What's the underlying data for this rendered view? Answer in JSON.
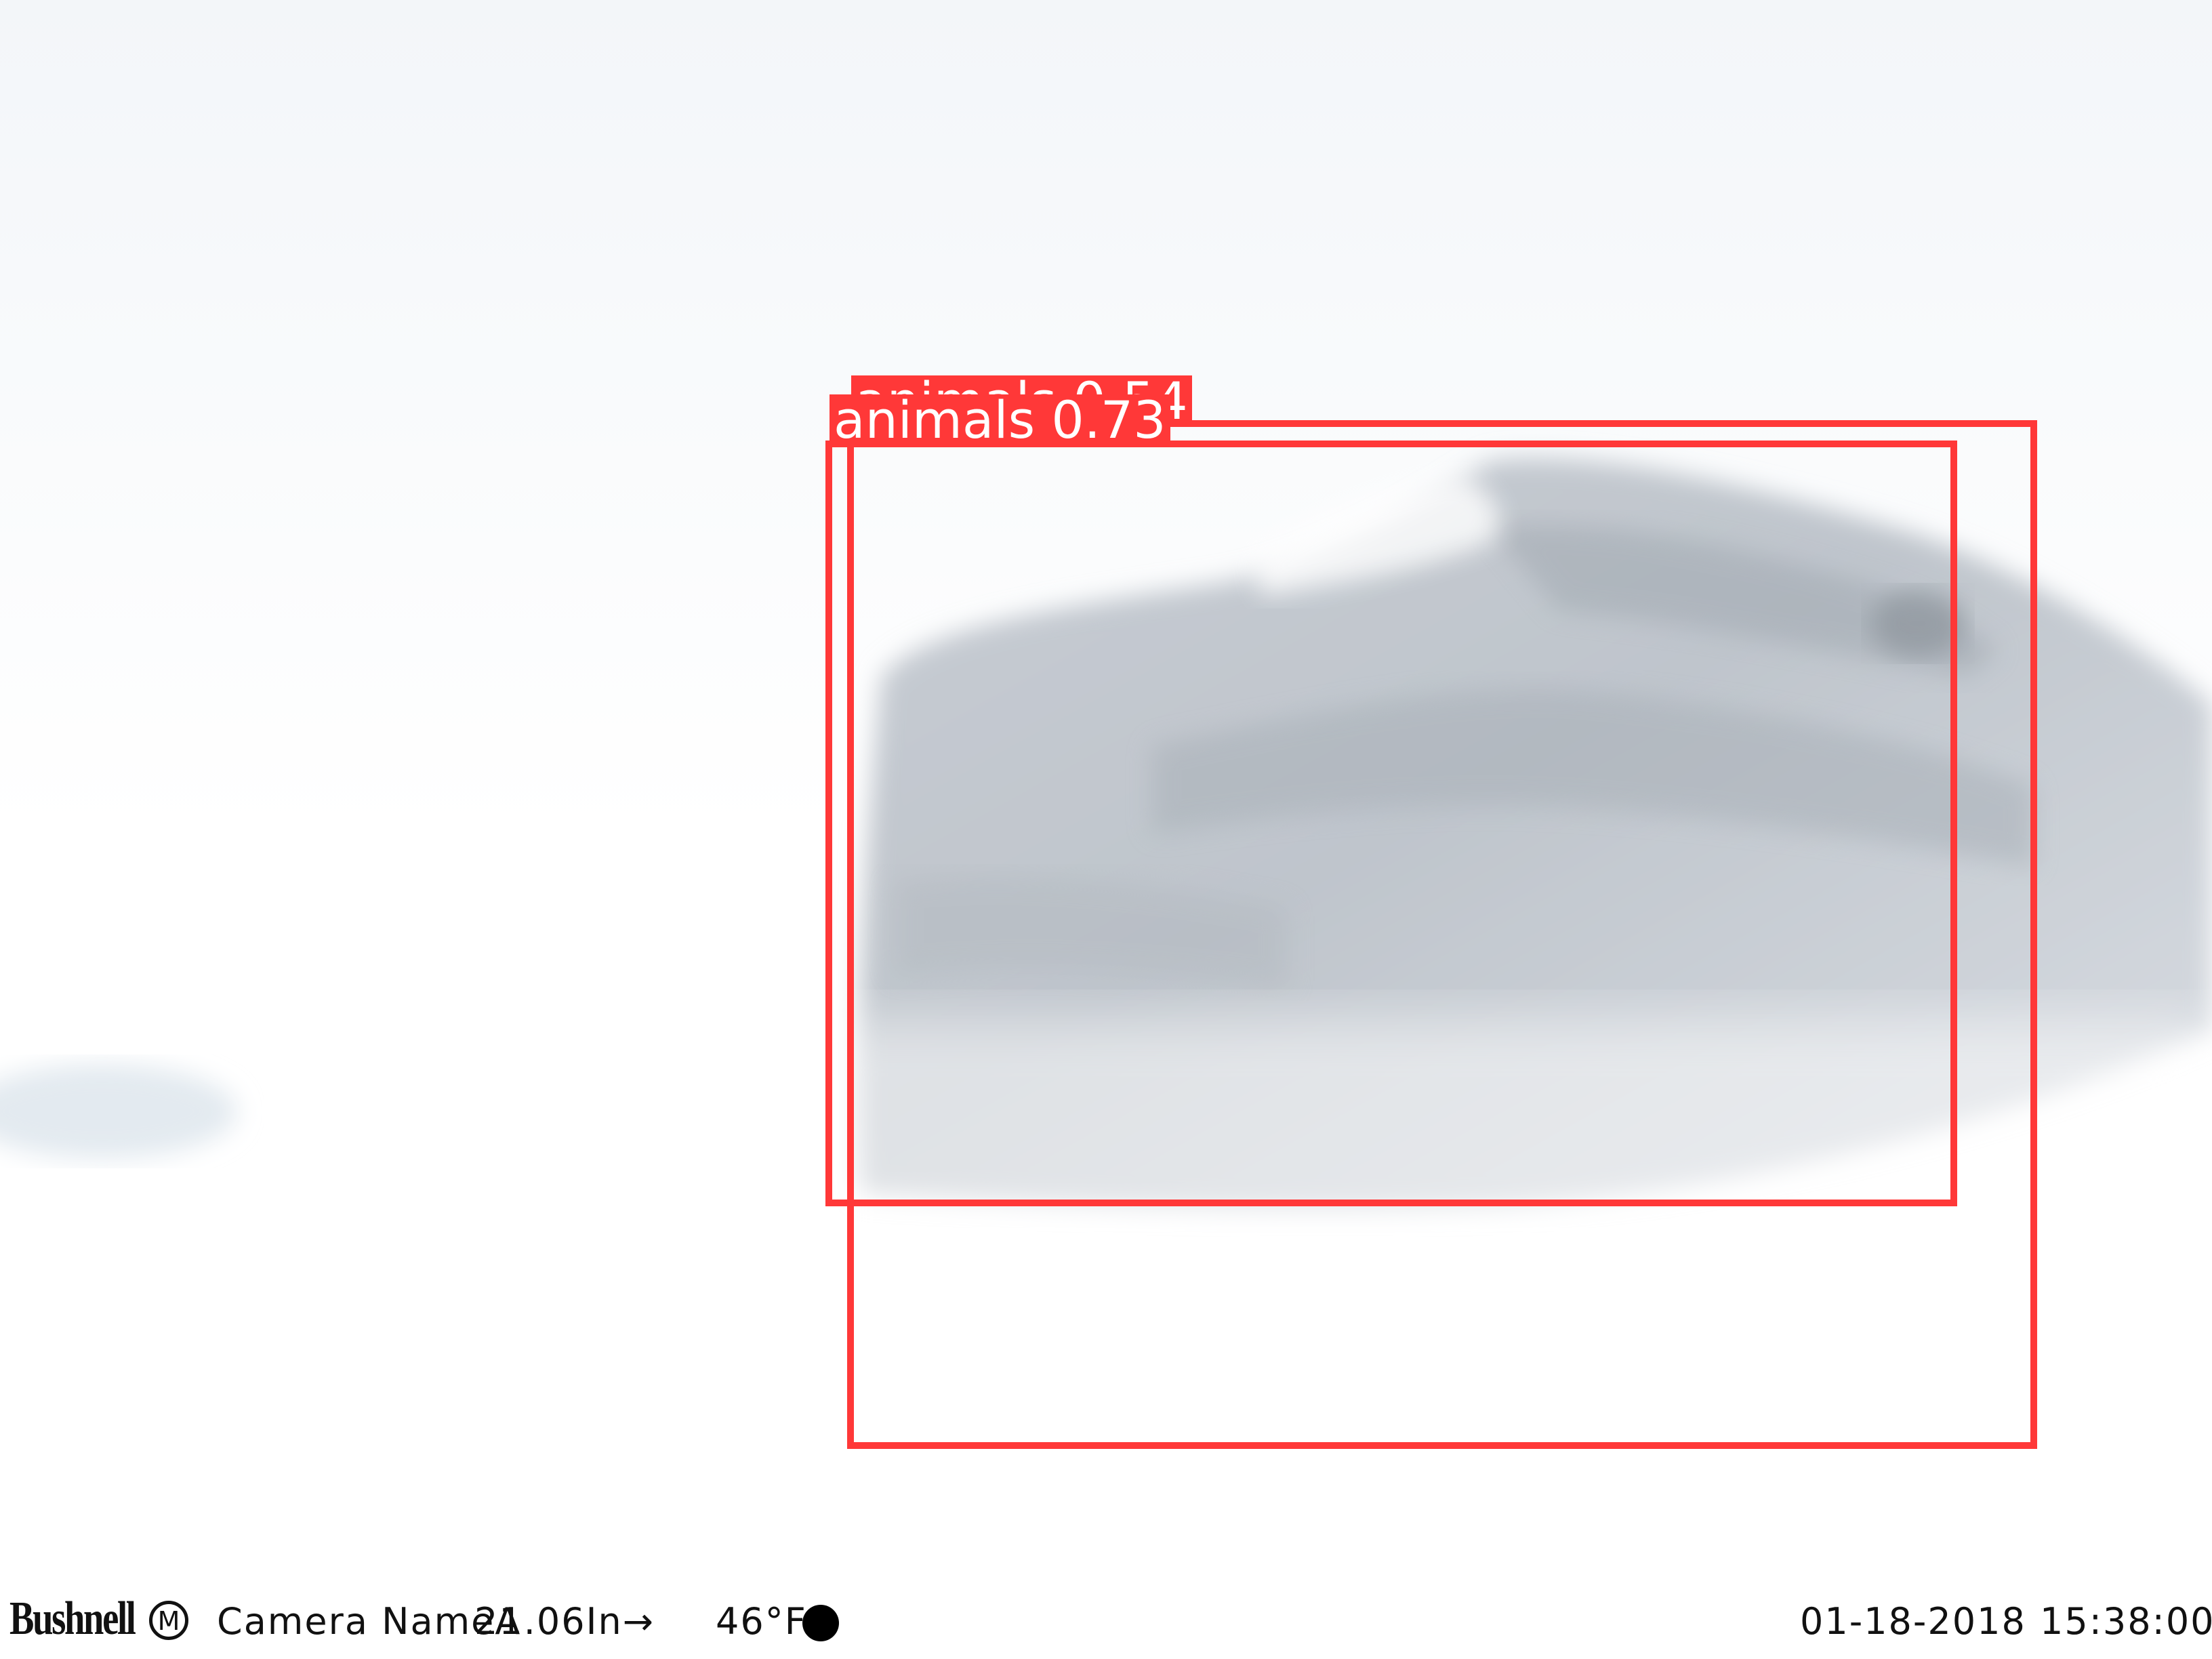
{
  "detections": [
    {
      "label": "animals",
      "score": "0.54"
    },
    {
      "label": "animals",
      "score": "0.73"
    }
  ],
  "overlay": {
    "brand": "Bushnell",
    "mode": "M",
    "camera_name": "Camera NameA",
    "pressure": "21.06In→",
    "temperature": "46°F",
    "date": "01-18-2018",
    "time": "15:38:00"
  },
  "colors": {
    "box": "#ff3838",
    "label_text": "#ffffff"
  },
  "icons": {
    "moon_phase": "full-moon-icon"
  }
}
